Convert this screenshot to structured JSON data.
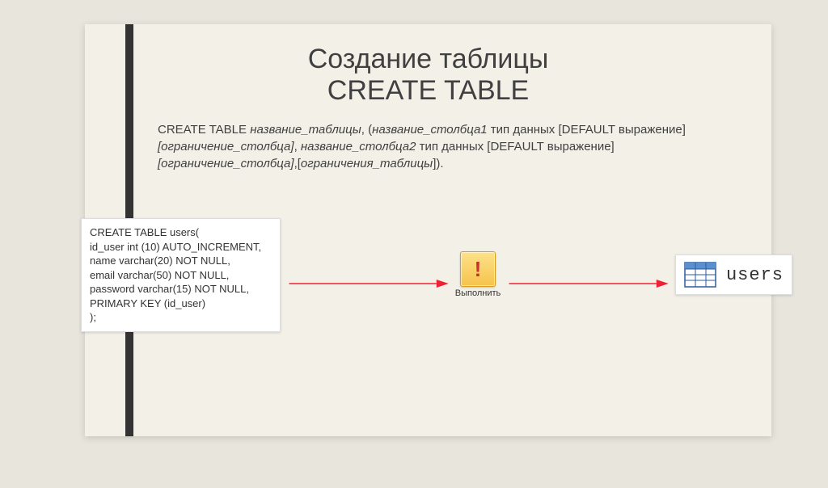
{
  "title": {
    "line1": "Создание таблицы",
    "line2": "CREATE TABLE"
  },
  "syntax": {
    "prefix": "CREATE TABLE ",
    "tableName": "название_таблицы",
    "sep1": ", (",
    "col1": "название_столбца1",
    "datatype": " тип данных [DEFAULT выражение] ",
    "colConstraint": "[ограничение_столбца]",
    "sep2": ", ",
    "col2": "название_столбца2",
    "datatype2": " тип данных [DEFAULT выражение] ",
    "colConstraint2": "[ограничение_столбца]",
    "sep3": ",[",
    "tableConstraint": "ограничения_таблицы",
    "tail": "])."
  },
  "code": {
    "line1": "CREATE TABLE users(",
    "line2": "id_user int (10) AUTO_INCREMENT,",
    "line3": "name varchar(20) NOT NULL,",
    "line4": "email varchar(50) NOT NULL,",
    "line5": "password varchar(15) NOT NULL,",
    "line6": "PRIMARY KEY (id_user)",
    "line7": ");"
  },
  "execute": {
    "label": "Выполнить",
    "icon": "!"
  },
  "result": {
    "tableName": "users"
  }
}
